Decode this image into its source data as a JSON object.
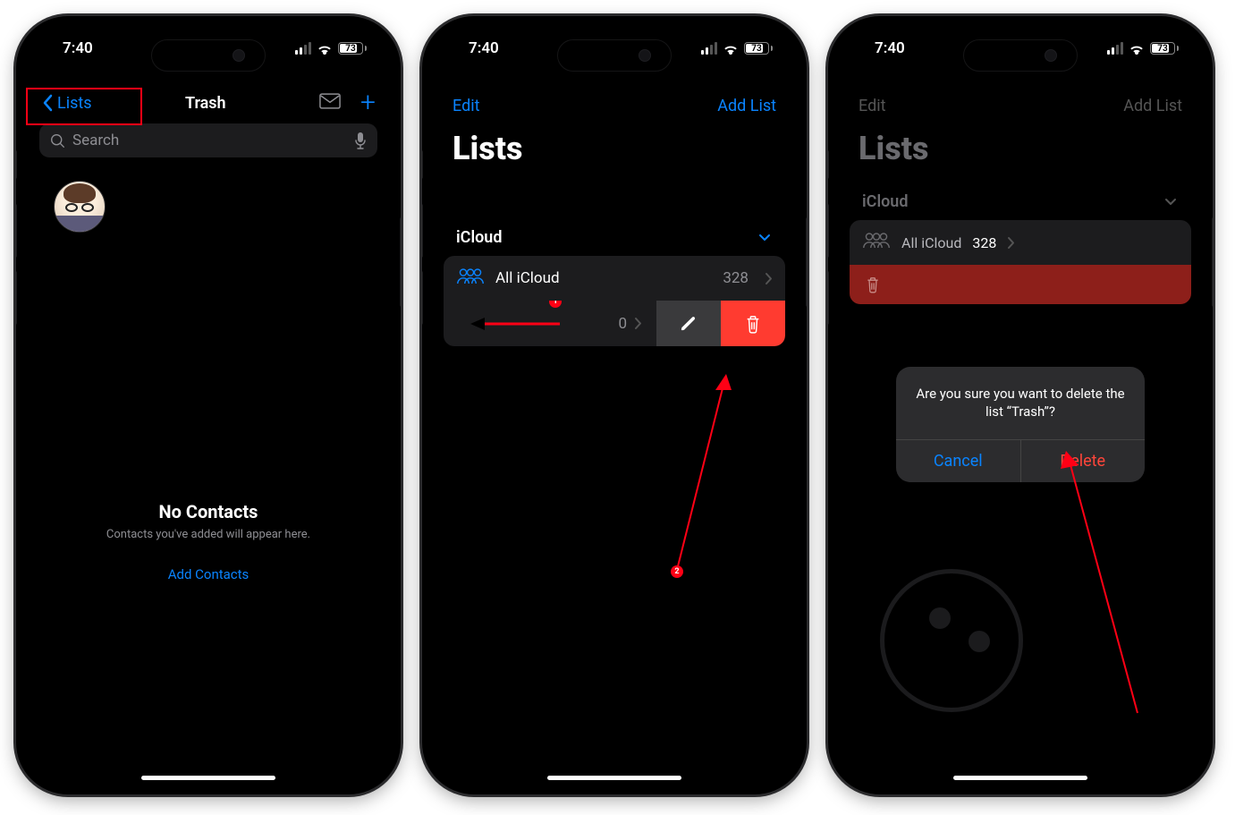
{
  "status": {
    "time": "7:40",
    "battery": "73"
  },
  "screen1": {
    "back_label": "Lists",
    "title": "Trash",
    "search_placeholder": "Search",
    "empty_title": "No Contacts",
    "empty_subtitle": "Contacts you've added will appear here.",
    "empty_link": "Add Contacts"
  },
  "screen2": {
    "edit": "Edit",
    "addlist": "Add List",
    "heading": "Lists",
    "group": "iCloud",
    "row_all_label": "All iCloud",
    "row_all_count": "328",
    "swiped_count": "0",
    "swipe_hint": "swipe",
    "badge1": "1",
    "badge2": "2"
  },
  "screen3": {
    "edit": "Edit",
    "addlist": "Add List",
    "heading": "Lists",
    "group": "iCloud",
    "row_all_label": "All iCloud",
    "row_all_count": "328",
    "alert_msg": "Are you sure you want to delete the list “Trash”?",
    "alert_cancel": "Cancel",
    "alert_delete": "Delete"
  }
}
